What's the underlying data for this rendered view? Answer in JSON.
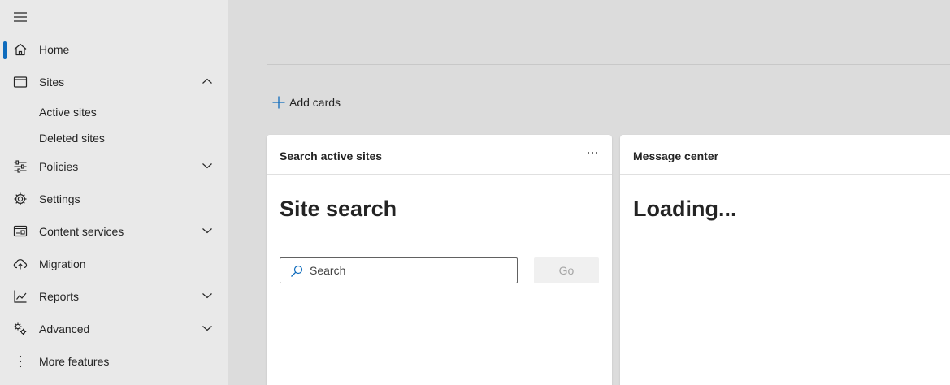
{
  "sidebar": {
    "menu_icon": "hamburger-icon",
    "items": [
      {
        "label": "Home",
        "icon": "home-icon",
        "active": true
      },
      {
        "label": "Sites",
        "icon": "browser-window-icon",
        "expanded": true
      },
      {
        "label": "Active sites",
        "sub": true
      },
      {
        "label": "Deleted sites",
        "sub": true
      },
      {
        "label": "Policies",
        "icon": "sliders-icon",
        "expandable": true
      },
      {
        "label": "Settings",
        "icon": "gear-icon"
      },
      {
        "label": "Content services",
        "icon": "content-services-icon",
        "expandable": true
      },
      {
        "label": "Migration",
        "icon": "cloud-upload-icon"
      },
      {
        "label": "Reports",
        "icon": "line-chart-icon",
        "expandable": true
      },
      {
        "label": "Advanced",
        "icon": "gears-icon",
        "expandable": true
      },
      {
        "label": "More features",
        "icon": "vertical-ellipsis-icon"
      }
    ]
  },
  "main": {
    "add_cards_label": "Add cards",
    "cards": [
      {
        "title": "Search active sites",
        "heading": "Site search",
        "search_placeholder": "Search",
        "go_label": "Go"
      },
      {
        "title": "Message center",
        "heading": "Loading..."
      }
    ]
  },
  "colors": {
    "accent": "#0f6cbd",
    "sidebar_bg": "#e9e9e9",
    "main_bg": "#dcdcdc",
    "card_bg": "#ffffff"
  }
}
